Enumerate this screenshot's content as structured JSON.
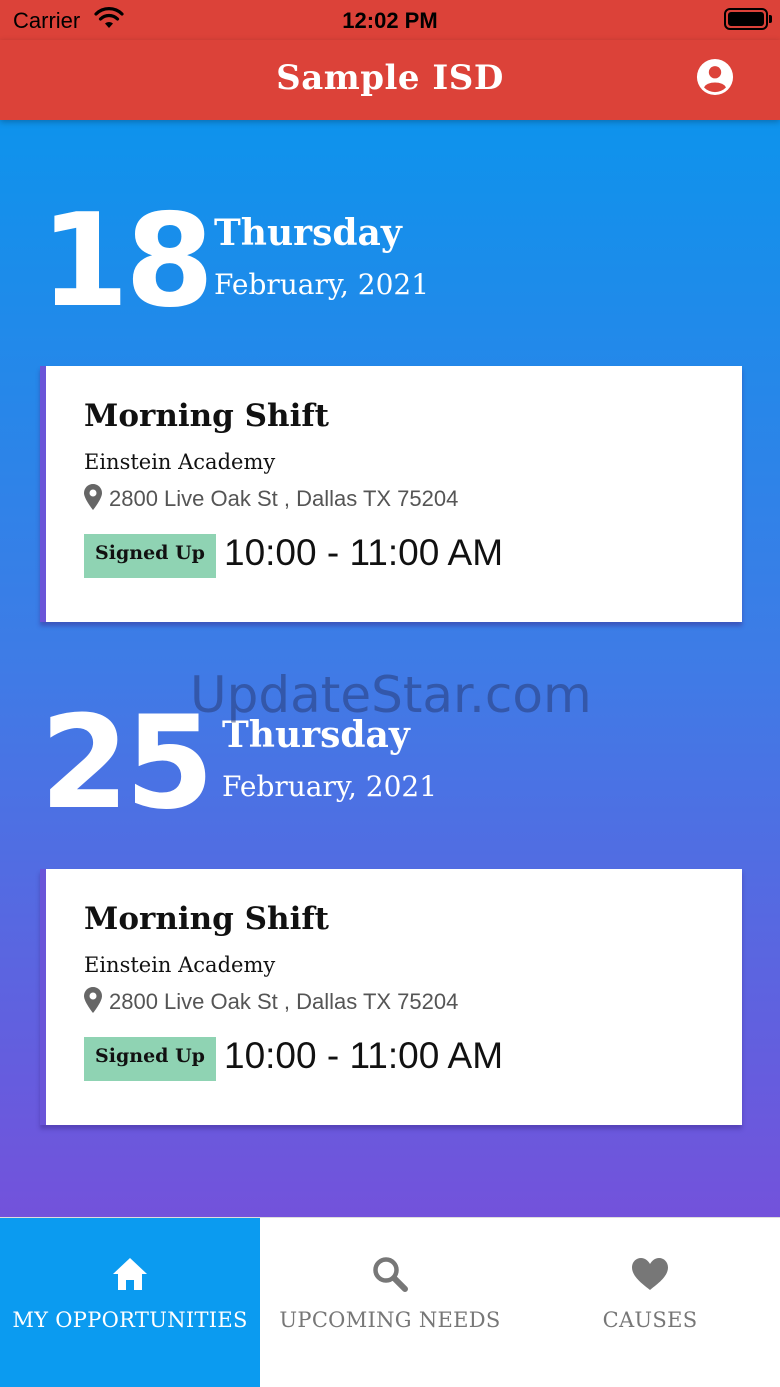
{
  "status_bar": {
    "carrier": "Carrier",
    "time": "12:02 PM"
  },
  "header": {
    "title": "Sample ISD",
    "profile_icon": "account-circle-icon",
    "color": "#dc4239"
  },
  "days": [
    {
      "day": "18",
      "weekday": "Thursday",
      "month_year": "February, 2021",
      "card": {
        "title": "Morning Shift",
        "school": "Einstein Academy",
        "address": "2800 Live Oak St , Dallas TX 75204",
        "status": "Signed Up",
        "time": "10:00 - 11:00 AM"
      }
    },
    {
      "day": "25",
      "weekday": "Thursday",
      "month_year": "February, 2021",
      "card": {
        "title": "Morning Shift",
        "school": "Einstein Academy",
        "address": "2800 Live Oak St , Dallas TX 75204",
        "status": "Signed Up",
        "time": "10:00 - 11:00 AM"
      }
    }
  ],
  "watermark": "UpdateStar.com",
  "tabs": [
    {
      "label": "MY OPPORTUNITIES",
      "icon": "home-icon",
      "active": true
    },
    {
      "label": "UPCOMING NEEDS",
      "icon": "search-icon",
      "active": false
    },
    {
      "label": "CAUSES",
      "icon": "heart-icon",
      "active": false
    }
  ],
  "colors": {
    "badge": "#8fd3b3",
    "active_tab": "#0b9bf0",
    "gradient_top": "#0e93ec",
    "gradient_bottom": "#7352db"
  }
}
